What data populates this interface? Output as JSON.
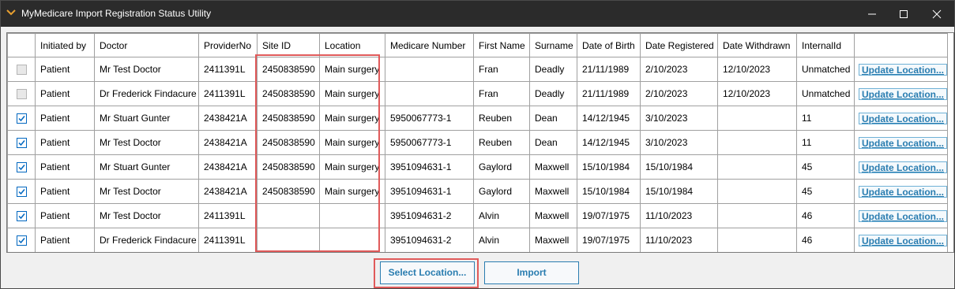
{
  "window": {
    "title": "MyMedicare Import Registration Status Utility"
  },
  "grid": {
    "columns": [
      "",
      "Initiated by",
      "Doctor",
      "ProviderNo",
      "Site ID",
      "Location",
      "Medicare Number",
      "First Name",
      "Surname",
      "Date of Birth",
      "Date Registered",
      "Date Withdrawn",
      "InternalId",
      ""
    ],
    "rows": [
      {
        "checked": false,
        "cells": [
          "Patient",
          "Mr Test Doctor",
          "2411391L",
          "2450838590",
          "Main surgery",
          "",
          "Fran",
          "Deadly",
          "21/11/1989",
          "2/10/2023",
          "12/10/2023",
          "Unmatched"
        ],
        "action": "Update Location..."
      },
      {
        "checked": false,
        "cells": [
          "Patient",
          "Dr Frederick Findacure",
          "2411391L",
          "2450838590",
          "Main surgery",
          "",
          "Fran",
          "Deadly",
          "21/11/1989",
          "2/10/2023",
          "12/10/2023",
          "Unmatched"
        ],
        "action": "Update Location..."
      },
      {
        "checked": true,
        "cells": [
          "Patient",
          "Mr Stuart Gunter",
          "2438421A",
          "2450838590",
          "Main surgery",
          "5950067773-1",
          "Reuben",
          "Dean",
          "14/12/1945",
          "3/10/2023",
          "",
          "11"
        ],
        "action": "Update Location..."
      },
      {
        "checked": true,
        "cells": [
          "Patient",
          "Mr Test Doctor",
          "2438421A",
          "2450838590",
          "Main surgery",
          "5950067773-1",
          "Reuben",
          "Dean",
          "14/12/1945",
          "3/10/2023",
          "",
          "11"
        ],
        "action": "Update Location..."
      },
      {
        "checked": true,
        "cells": [
          "Patient",
          "Mr Stuart Gunter",
          "2438421A",
          "2450838590",
          "Main surgery",
          "3951094631-1",
          "Gaylord",
          "Maxwell",
          "15/10/1984",
          "15/10/1984",
          "",
          "45"
        ],
        "action": "Update Location..."
      },
      {
        "checked": true,
        "cells": [
          "Patient",
          "Mr Test Doctor",
          "2438421A",
          "2450838590",
          "Main surgery",
          "3951094631-1",
          "Gaylord",
          "Maxwell",
          "15/10/1984",
          "15/10/1984",
          "",
          "45"
        ],
        "action": "Update Location..."
      },
      {
        "checked": true,
        "cells": [
          "Patient",
          "Mr Test Doctor",
          "2411391L",
          "",
          "",
          "3951094631-2",
          "Alvin",
          "Maxwell",
          "19/07/1975",
          "11/10/2023",
          "",
          "46"
        ],
        "action": "Update Location..."
      },
      {
        "checked": true,
        "cells": [
          "Patient",
          "Dr Frederick Findacure",
          "2411391L",
          "",
          "",
          "3951094631-2",
          "Alvin",
          "Maxwell",
          "19/07/1975",
          "11/10/2023",
          "",
          "46"
        ],
        "action": "Update Location..."
      }
    ]
  },
  "buttons": {
    "select_location": "Select Location...",
    "import": "Import"
  },
  "colors": {
    "accent": "#2a7db0",
    "highlight": "#e05a5a",
    "checkbox": "#0067c0",
    "titlebar": "#2b2b2b"
  }
}
